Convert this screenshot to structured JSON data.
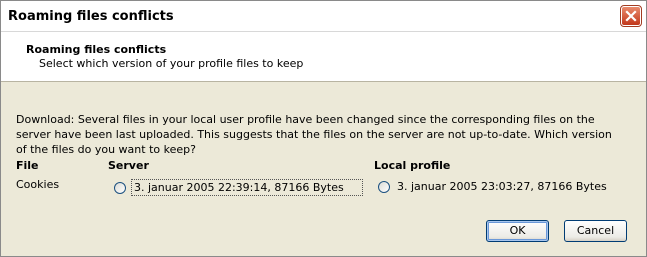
{
  "window": {
    "title": "Roaming files conflicts"
  },
  "header": {
    "title": "Roaming files conflicts",
    "subtitle": "Select which version of your profile files to keep"
  },
  "description": "Download: Several files in your local user profile have been changed since the corresponding files on the server have been last uploaded. This suggests that the files on the server are not up-to-date. Which version of the files do you want to keep?",
  "table": {
    "columns": {
      "file": "File",
      "server": "Server",
      "local": "Local profile"
    },
    "rows": [
      {
        "file": "Cookies",
        "server": "3. januar 2005 22:39:14, 87166 Bytes",
        "local": "3. januar 2005 23:03:27, 87166 Bytes"
      }
    ]
  },
  "buttons": {
    "ok": "OK",
    "cancel": "Cancel"
  },
  "icons": {
    "close": "close-icon"
  },
  "colors": {
    "close_button": "#c2371b",
    "dialog_bg": "#ece9d8"
  }
}
